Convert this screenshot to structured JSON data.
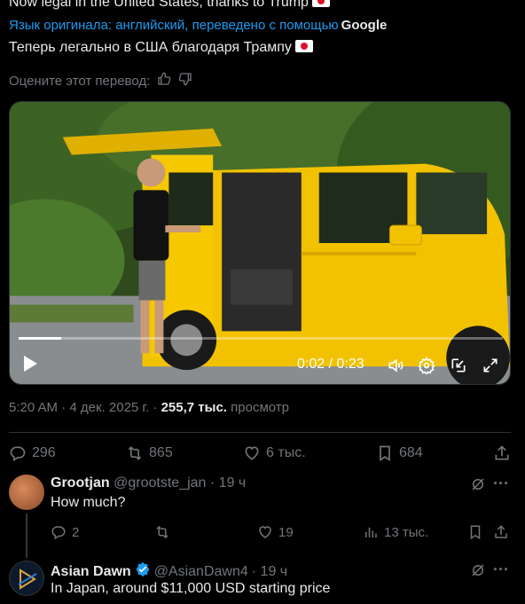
{
  "post": {
    "original_text": "Now legal in the United States, thanks to Trump",
    "translated_by_label": "Язык оригинала: английский, переведено с помощью",
    "translated_by_brand": "Google",
    "translated_text": "Теперь легально в США благодаря Трампу",
    "rate_label": "Оцените этот перевод:",
    "video": {
      "current_time": "0:02",
      "duration": "0:23",
      "progress": 0.087
    },
    "meta": {
      "time": "5:20 AM",
      "date": "4 дек. 2025 г.",
      "views": "255,7 тыс.",
      "views_label": "просмотр"
    },
    "stats": {
      "replies": "296",
      "reposts": "865",
      "likes": "6 тыс.",
      "bookmarks": "684"
    }
  },
  "replies": [
    {
      "name": "Grootjan",
      "handle": "@grootste_jan",
      "age": "· 19 ч",
      "text": "How much?",
      "replies": "2",
      "likes": "19",
      "views": "13 тыс."
    },
    {
      "name": "Asian Dawn",
      "handle": "@AsianDawn4",
      "age": "· 19 ч",
      "text": "In Japan, around $11,000 USD starting price",
      "verified": true
    }
  ],
  "colors": {
    "accent": "#1d9bf0",
    "muted": "#71767b",
    "van_yellow": "#f2c200"
  }
}
